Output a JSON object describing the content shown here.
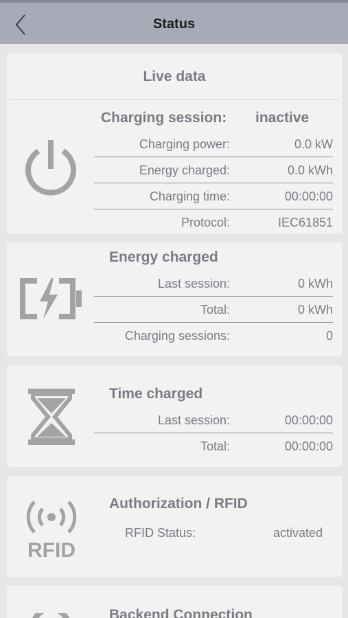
{
  "header": {
    "title": "Status"
  },
  "live": {
    "heading": "Live data",
    "session_label": "Charging session:",
    "session_value": "inactive",
    "rows": [
      {
        "label": "Charging power:",
        "value": "0.0 kW"
      },
      {
        "label": "Energy charged:",
        "value": "0.0 kWh"
      },
      {
        "label": "Charging time:",
        "value": "00:00:00"
      },
      {
        "label": "Protocol:",
        "value": "IEC61851"
      }
    ]
  },
  "energy": {
    "heading": "Energy charged",
    "rows": [
      {
        "label": "Last session:",
        "value": "0 kWh"
      },
      {
        "label": "Total:",
        "value": "0 kWh"
      },
      {
        "label": "Charging sessions:",
        "value": "0"
      }
    ]
  },
  "time": {
    "heading": "Time charged",
    "rows": [
      {
        "label": "Last session:",
        "value": "00:00:00"
      },
      {
        "label": "Total:",
        "value": "00:00:00"
      }
    ]
  },
  "auth": {
    "heading": "Authorization / RFID",
    "status_label": "RFID Status:",
    "status_value": "activated",
    "icon_text": "RFID"
  },
  "backend": {
    "heading": "Backend Connection"
  },
  "icons": [
    "back-chevron-icon",
    "power-icon",
    "battery-charging-icon",
    "hourglass-icon",
    "rfid-icon",
    "backend-icon"
  ],
  "colors": {
    "header_bg": "#a8abb7",
    "card_bg": "#f2f2f2",
    "text": "#7a7c84",
    "page_bg": "#e6e6e6"
  }
}
